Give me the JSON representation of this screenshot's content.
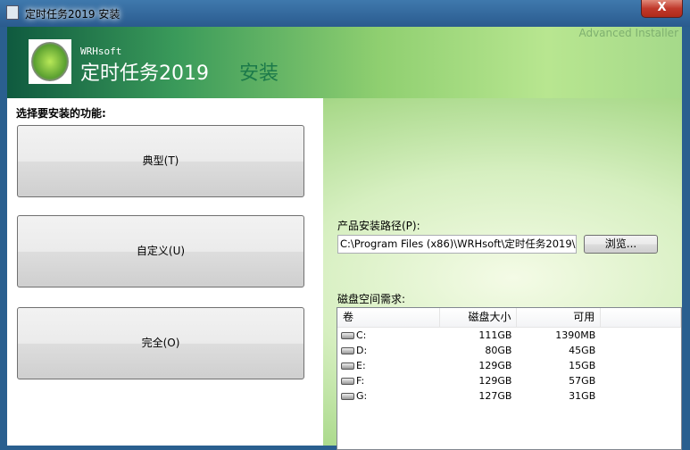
{
  "window": {
    "title": "定时任务2019 安装",
    "close_label": "X"
  },
  "banner": {
    "brand": "Advanced Installer",
    "vendor": "WRHsoft",
    "product": "定时任务2019",
    "action": "安装"
  },
  "features": {
    "heading": "选择要安装的功能:",
    "buttons": [
      {
        "label": "典型(T)"
      },
      {
        "label": "自定义(U)"
      },
      {
        "label": "完全(O)"
      }
    ]
  },
  "install_path": {
    "label": "产品安装路径(P):",
    "value": "C:\\Program Files (x86)\\WRHsoft\\定时任务2019\\",
    "browse_label": "浏览..."
  },
  "disk": {
    "label": "磁盘空间需求:",
    "columns": [
      "卷",
      "磁盘大小",
      "可用",
      ""
    ],
    "rows": [
      {
        "volume": "C:",
        "size": "111GB",
        "free": "1390MB"
      },
      {
        "volume": "D:",
        "size": "80GB",
        "free": "45GB"
      },
      {
        "volume": "E:",
        "size": "129GB",
        "free": "15GB"
      },
      {
        "volume": "F:",
        "size": "129GB",
        "free": "57GB"
      },
      {
        "volume": "G:",
        "size": "127GB",
        "free": "31GB"
      }
    ]
  }
}
